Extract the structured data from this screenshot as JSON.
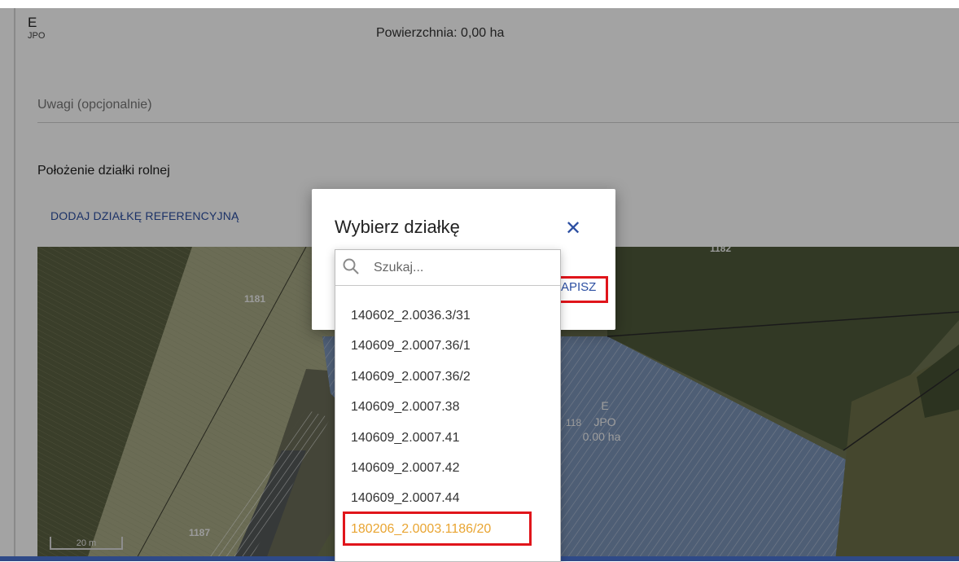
{
  "header": {
    "code": "E",
    "sub": "JPO",
    "area": "Powierzchnia: 0,00 ha"
  },
  "form": {
    "notes_placeholder": "Uwagi (opcjonalnie)",
    "section_title": "Położenie działki rolnej",
    "add_reference": "DODAJ DZIAŁKĘ REFERENCYJNĄ"
  },
  "map": {
    "labels": [
      "1181",
      "1187",
      "118",
      "1182"
    ],
    "parcel": {
      "code": "E",
      "sub": "JPO",
      "area": "0.00 ha"
    },
    "scale": "20 m"
  },
  "dialog": {
    "title": "Wybierz działkę",
    "close_icon": "close-icon",
    "save_label": "APISZ",
    "search_placeholder": "Szukaj...",
    "items": [
      "140602_2.0036.3/31",
      "140609_2.0007.36/1",
      "140609_2.0007.36/2",
      "140609_2.0007.38",
      "140609_2.0007.41",
      "140609_2.0007.42",
      "140609_2.0007.44",
      "180206_2.0003.1186/20"
    ],
    "highlighted_index": 7
  },
  "colors": {
    "accent": "#2c4fa2",
    "highlight": "#e9a532",
    "annotation": "#e0151b"
  }
}
